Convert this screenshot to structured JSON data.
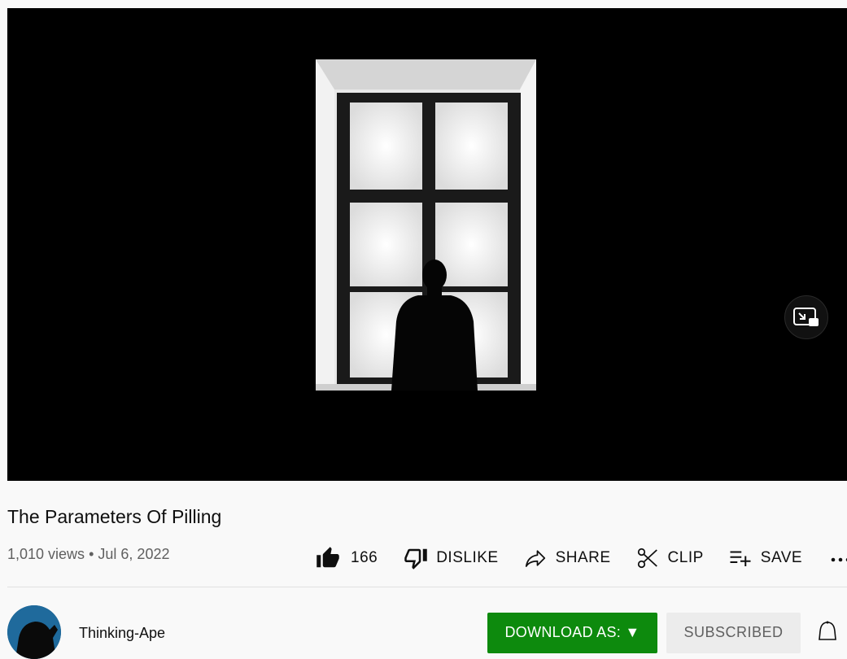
{
  "video": {
    "title": "The Parameters Of Pilling",
    "views": "1,010 views",
    "separator": "•",
    "date": "Jul 6, 2022"
  },
  "actions": {
    "like_count": "166",
    "dislike_label": "DISLIKE",
    "share_label": "SHARE",
    "clip_label": "CLIP",
    "save_label": "SAVE"
  },
  "channel": {
    "name": "Thinking-Ape",
    "download_label": "DOWNLOAD AS: ▼",
    "subscribed_label": "SUBSCRIBED"
  },
  "icons": {
    "like": "thumb-up-filled-icon",
    "dislike": "thumb-down-outline-icon",
    "share": "share-arrow-icon",
    "clip": "scissors-icon",
    "save": "playlist-add-icon",
    "more": "more-horizontal-icon",
    "miniplayer": "miniplayer-icon",
    "bell": "bell-icon"
  },
  "colors": {
    "download_button": "#0d8a0d",
    "subscribed_button": "#ececec",
    "player_background": "#000000"
  }
}
